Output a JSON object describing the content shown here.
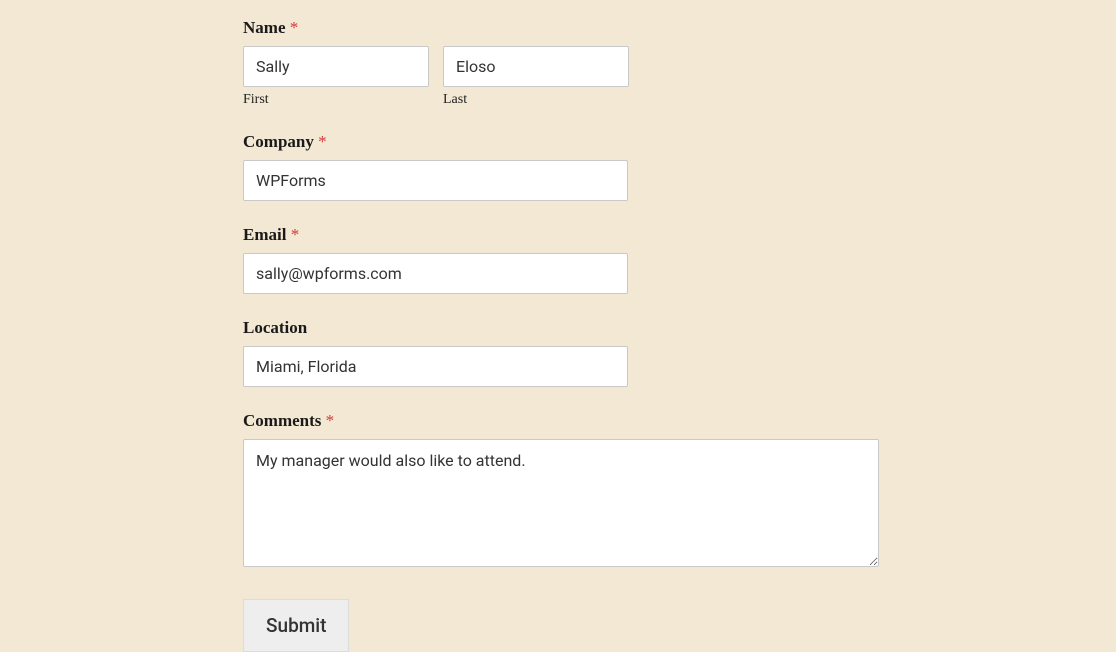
{
  "form": {
    "name": {
      "label": "Name",
      "required": "*",
      "first_sublabel": "First",
      "last_sublabel": "Last",
      "first_value": "Sally",
      "last_value": "Eloso"
    },
    "company": {
      "label": "Company",
      "required": "*",
      "value": "WPForms"
    },
    "email": {
      "label": "Email",
      "required": "*",
      "value": "sally@wpforms.com"
    },
    "location": {
      "label": "Location",
      "value": "Miami, Florida"
    },
    "comments": {
      "label": "Comments",
      "required": "*",
      "value": "My manager would also like to attend."
    },
    "submit_label": "Submit"
  }
}
